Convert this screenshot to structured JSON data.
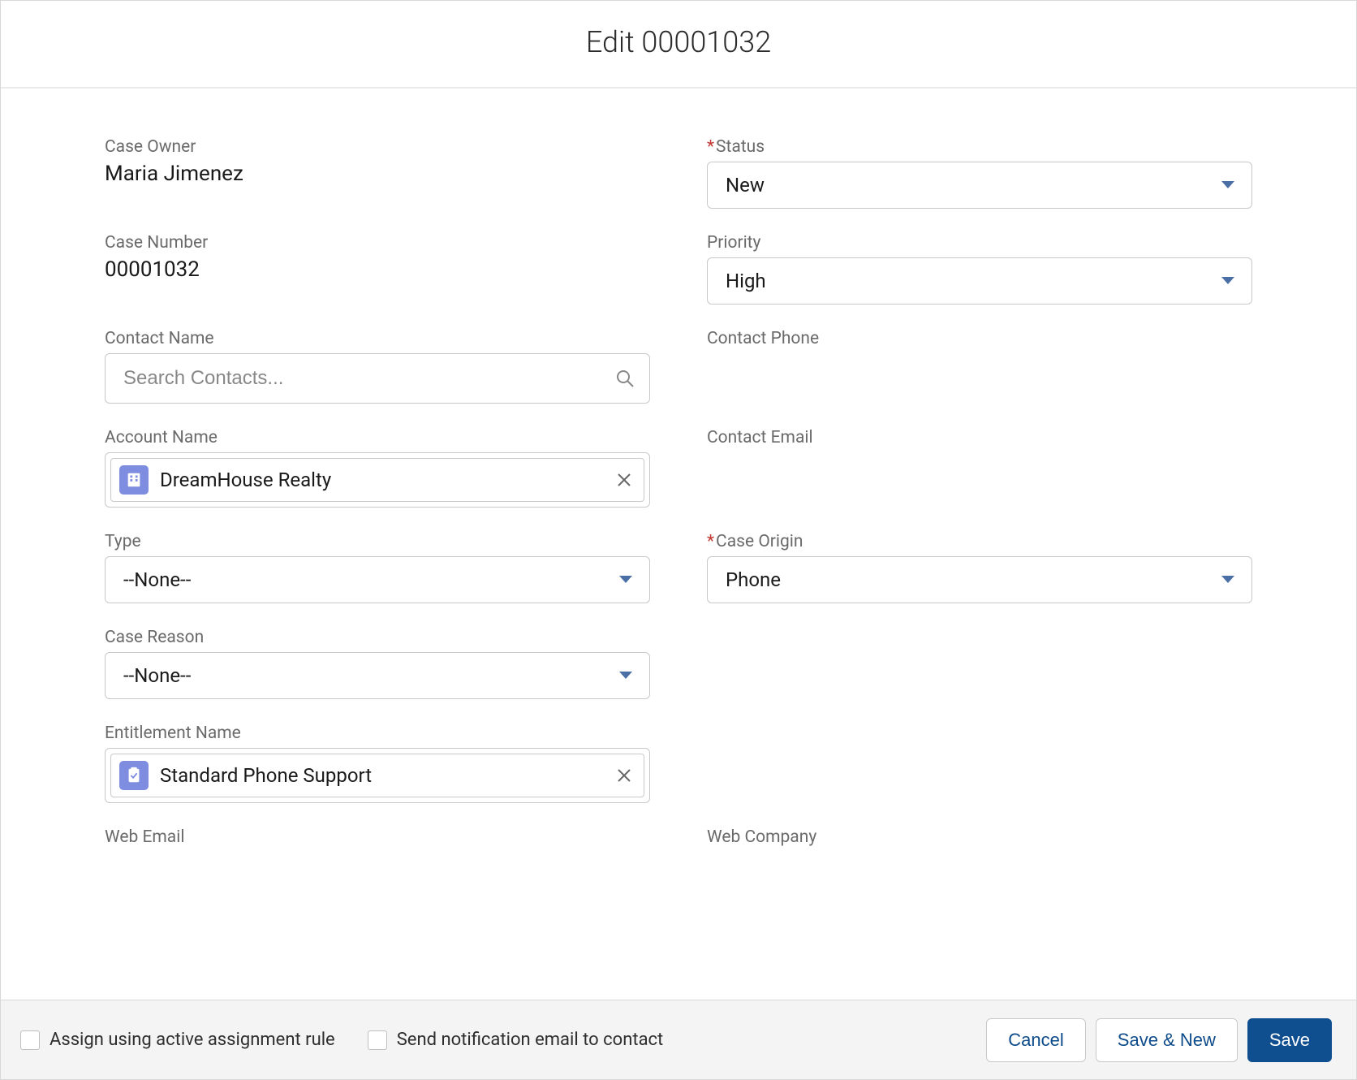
{
  "header": {
    "title": "Edit 00001032"
  },
  "fields": {
    "caseOwner": {
      "label": "Case Owner",
      "value": "Maria Jimenez"
    },
    "status": {
      "label": "Status",
      "value": "New",
      "required": true
    },
    "caseNumber": {
      "label": "Case Number",
      "value": "00001032"
    },
    "priority": {
      "label": "Priority",
      "value": "High"
    },
    "contactName": {
      "label": "Contact Name",
      "placeholder": "Search Contacts..."
    },
    "contactPhone": {
      "label": "Contact Phone",
      "value": ""
    },
    "accountName": {
      "label": "Account Name",
      "value": "DreamHouse Realty"
    },
    "contactEmail": {
      "label": "Contact Email",
      "value": ""
    },
    "type": {
      "label": "Type",
      "value": "--None--"
    },
    "caseOrigin": {
      "label": "Case Origin",
      "value": "Phone",
      "required": true
    },
    "caseReason": {
      "label": "Case Reason",
      "value": "--None--"
    },
    "entitlement": {
      "label": "Entitlement Name",
      "value": "Standard Phone Support"
    },
    "webEmail": {
      "label": "Web Email"
    },
    "webCompany": {
      "label": "Web Company"
    }
  },
  "footer": {
    "assignRule": "Assign using active assignment rule",
    "sendNotif": "Send notification email to contact",
    "cancel": "Cancel",
    "saveNew": "Save & New",
    "save": "Save"
  },
  "required_mark": "*"
}
